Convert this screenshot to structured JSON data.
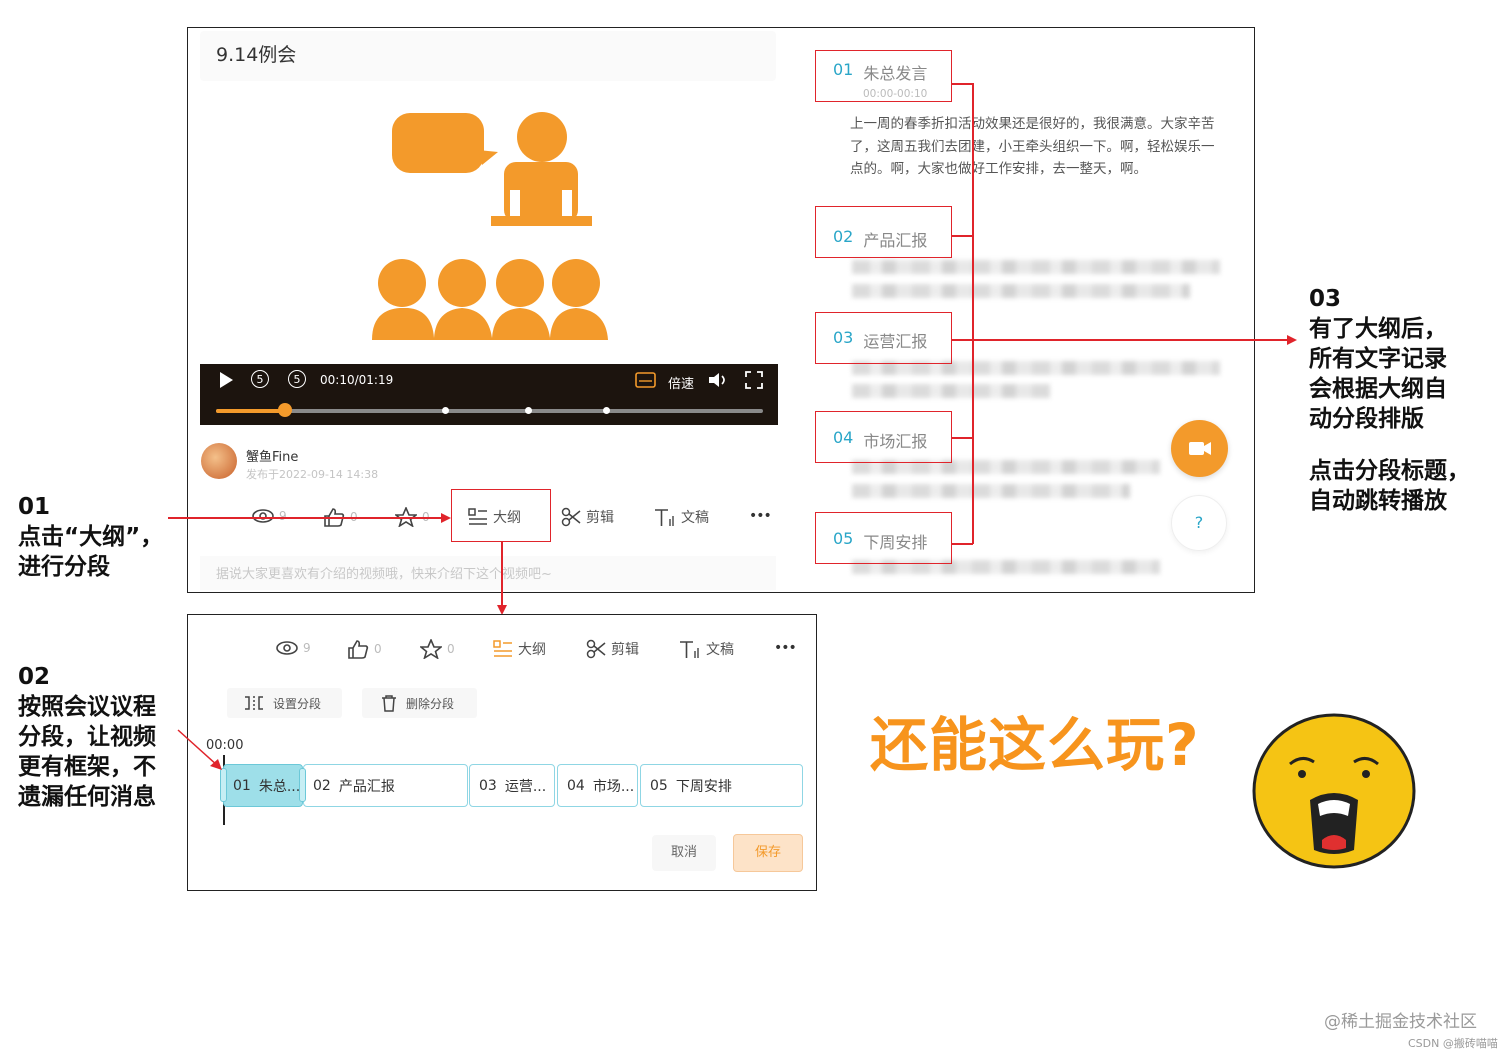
{
  "meeting_title": "9.14例会",
  "player": {
    "time": "00:10/01:19",
    "speed_label": "倍速",
    "progress_fraction": 0.127
  },
  "author": {
    "name": "蟹鱼Fine",
    "published": "发布于2022-09-14 14:38"
  },
  "actions": {
    "views": "9",
    "likes": "0",
    "stars": "0",
    "outline": "大纲",
    "edit": "剪辑",
    "manuscript": "文稿",
    "more": "•••"
  },
  "description_placeholder": "据说大家更喜欢有介绍的视频哦，快来介绍下这个视频吧~",
  "outline_sections": [
    {
      "num": "01",
      "title": "朱总发言",
      "time": "00:00-00:10"
    },
    {
      "num": "02",
      "title": "产品汇报"
    },
    {
      "num": "03",
      "title": "运营汇报"
    },
    {
      "num": "04",
      "title": "市场汇报"
    },
    {
      "num": "05",
      "title": "下周安排"
    }
  ],
  "transcript_text": "上一周的春季折扣活动效果还是很好的，我很满意。大家辛苦了，这周五我们去团建，小王牵头组织一下。啊，轻松娱乐一点的。啊，大家也做好工作安排，去一整天，啊。",
  "help_label": "?",
  "editor": {
    "set_segment": "设置分段",
    "delete_segment": "删除分段",
    "timeline_start": "00:00",
    "segments": [
      {
        "num": "01",
        "label": "朱总..."
      },
      {
        "num": "02",
        "label": "产品汇报"
      },
      {
        "num": "03",
        "label": "运营..."
      },
      {
        "num": "04",
        "label": "市场..."
      },
      {
        "num": "05",
        "label": "下周安排"
      }
    ],
    "cancel": "取消",
    "save": "保存"
  },
  "annotations": {
    "a01": {
      "num": "01",
      "lines": [
        "点击“大纲”，",
        "进行分段"
      ]
    },
    "a02": {
      "num": "02",
      "lines": [
        "按照会议议程",
        "分段，让视频",
        "更有框架，不",
        "遗漏任何消息"
      ]
    },
    "a03": {
      "num": "03",
      "lines": [
        "有了大纲后，",
        "所有文字记录",
        "会根据大纲自",
        "动分段排版",
        "",
        "点击分段标题，",
        "自动跳转播放"
      ]
    }
  },
  "exclaim": "还能这么玩?",
  "watermark": "@稀土掘金技术社区",
  "watermark2": "CSDN @搬砖喵喵",
  "colors": {
    "accent_orange": "#f39a2b",
    "teal": "#2aa6c8",
    "red_annot": "#e0242b"
  }
}
